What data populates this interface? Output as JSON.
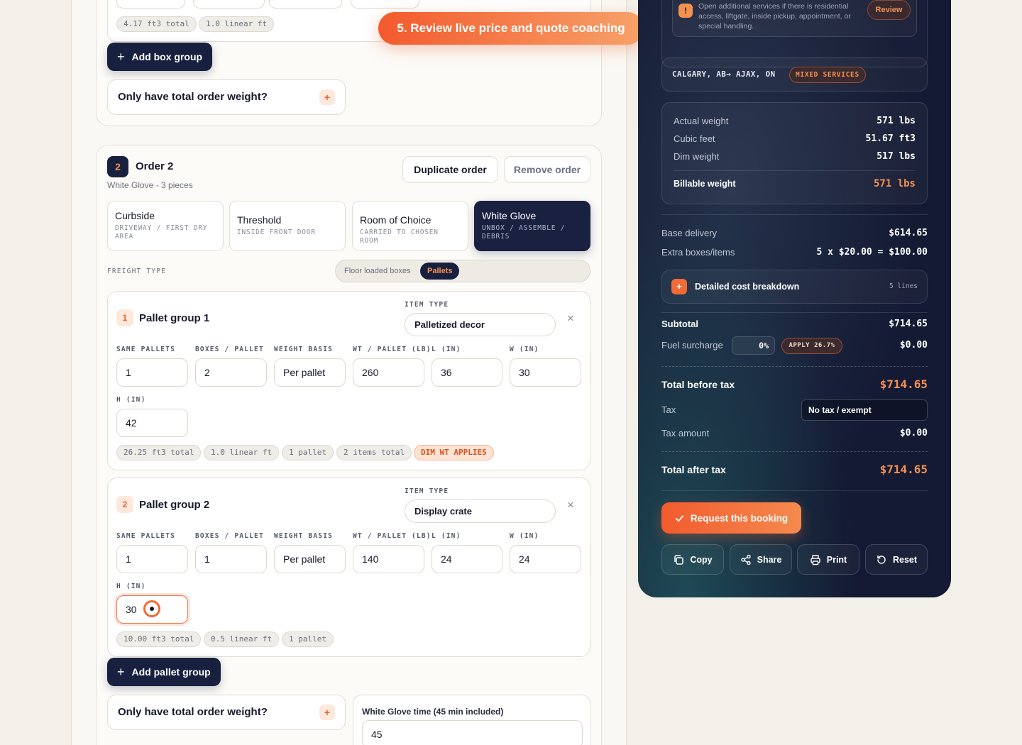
{
  "order1": {
    "box_chips": [
      "4.17 ft3 total",
      "1.0 linear ft"
    ],
    "add_box_group": "Add box group",
    "total_weight_prompt": "Only have total order weight?",
    "plus": "+"
  },
  "tour": {
    "step": "5. Review live price and quote coaching"
  },
  "order2": {
    "number": "2",
    "title": "Order 2",
    "subtitle": "White Glove - 3 pieces",
    "duplicate": "Duplicate order",
    "remove": "Remove order",
    "services": [
      {
        "title": "Curbside",
        "sub": "DRIVEWAY / FIRST DRY AREA"
      },
      {
        "title": "Threshold",
        "sub": "INSIDE FRONT DOOR"
      },
      {
        "title": "Room of Choice",
        "sub": "CARRIED TO CHOSEN ROOM"
      },
      {
        "title": "White Glove",
        "sub": "UNBOX / ASSEMBLE / DEBRIS"
      }
    ],
    "freight_type_label": "FREIGHT TYPE",
    "freight_options": [
      "Floor loaded boxes",
      "Pallets"
    ],
    "field_labels": {
      "item_type": "ITEM TYPE",
      "same_pallets": "SAME PALLETS",
      "boxes_per_pallet": "BOXES / PALLET",
      "weight_basis": "WEIGHT BASIS",
      "wt_per_pallet": "WT / PALLET (LB)",
      "l": "L (IN)",
      "w": "W (IN)",
      "h": "H (IN)"
    },
    "close": "×",
    "groups": [
      {
        "num": "1",
        "title": "Pallet group 1",
        "item_type": "Palletized decor",
        "same_pallets": "1",
        "boxes_per_pallet": "2",
        "weight_basis": "Per pallet",
        "wt": "260",
        "l": "36",
        "w": "30",
        "h": "42",
        "chips": [
          "26.25 ft3 total",
          "1.0 linear ft",
          "1 pallet",
          "2 items total"
        ],
        "warn": "DIM WT APPLIES"
      },
      {
        "num": "2",
        "title": "Pallet group 2",
        "item_type": "Display crate",
        "same_pallets": "1",
        "boxes_per_pallet": "1",
        "weight_basis": "Per pallet",
        "wt": "140",
        "l": "24",
        "w": "24",
        "h": "30",
        "chips": [
          "10.00 ft3 total",
          "0.5 linear ft",
          "1 pallet"
        ]
      }
    ],
    "add_pallet_group": "Add pallet group",
    "total_weight_prompt": "Only have total order weight?",
    "wg_time_label": "White Glove time (45 min included)",
    "wg_time_value": "45"
  },
  "quote": {
    "notice": "Open additional services if there is residential access, liftgate, inside pickup, appointment, or special handling.",
    "notice_icon": "!",
    "review": "Review",
    "route": "CALGARY, AB→ AJAX, ON",
    "route_badge": "MIXED SERVICES",
    "weights": [
      {
        "label": "Actual weight",
        "value": "571 lbs"
      },
      {
        "label": "Cubic feet",
        "value": "51.67 ft3"
      },
      {
        "label": "Dim weight",
        "value": "517 lbs"
      }
    ],
    "billable_label": "Billable weight",
    "billable_value": "571 lbs",
    "base_delivery_label": "Base delivery",
    "base_delivery_value": "$614.65",
    "extra_label": "Extra boxes/items",
    "extra_value": "5 x $20.00 = $100.00",
    "breakdown_label": "Detailed cost breakdown",
    "breakdown_count": "5 lines",
    "subtotal_label": "Subtotal",
    "subtotal_value": "$714.65",
    "fuel_label": "Fuel surcharge",
    "fuel_input": "0%",
    "fuel_apply": "APPLY 26.7%",
    "fuel_value": "$0.00",
    "before_tax_label": "Total before tax",
    "before_tax_value": "$714.65",
    "tax_label": "Tax",
    "tax_select": "No tax / exempt",
    "tax_amount_label": "Tax amount",
    "tax_amount_value": "$0.00",
    "after_tax_label": "Total after tax",
    "after_tax_value": "$714.65",
    "request": "Request this booking",
    "actions": [
      "Copy",
      "Share",
      "Print",
      "Reset"
    ]
  },
  "colors": {
    "accent": "#f26a36",
    "navy": "#18203f",
    "panel": "#141a33",
    "orange_text": "#f5914f"
  }
}
